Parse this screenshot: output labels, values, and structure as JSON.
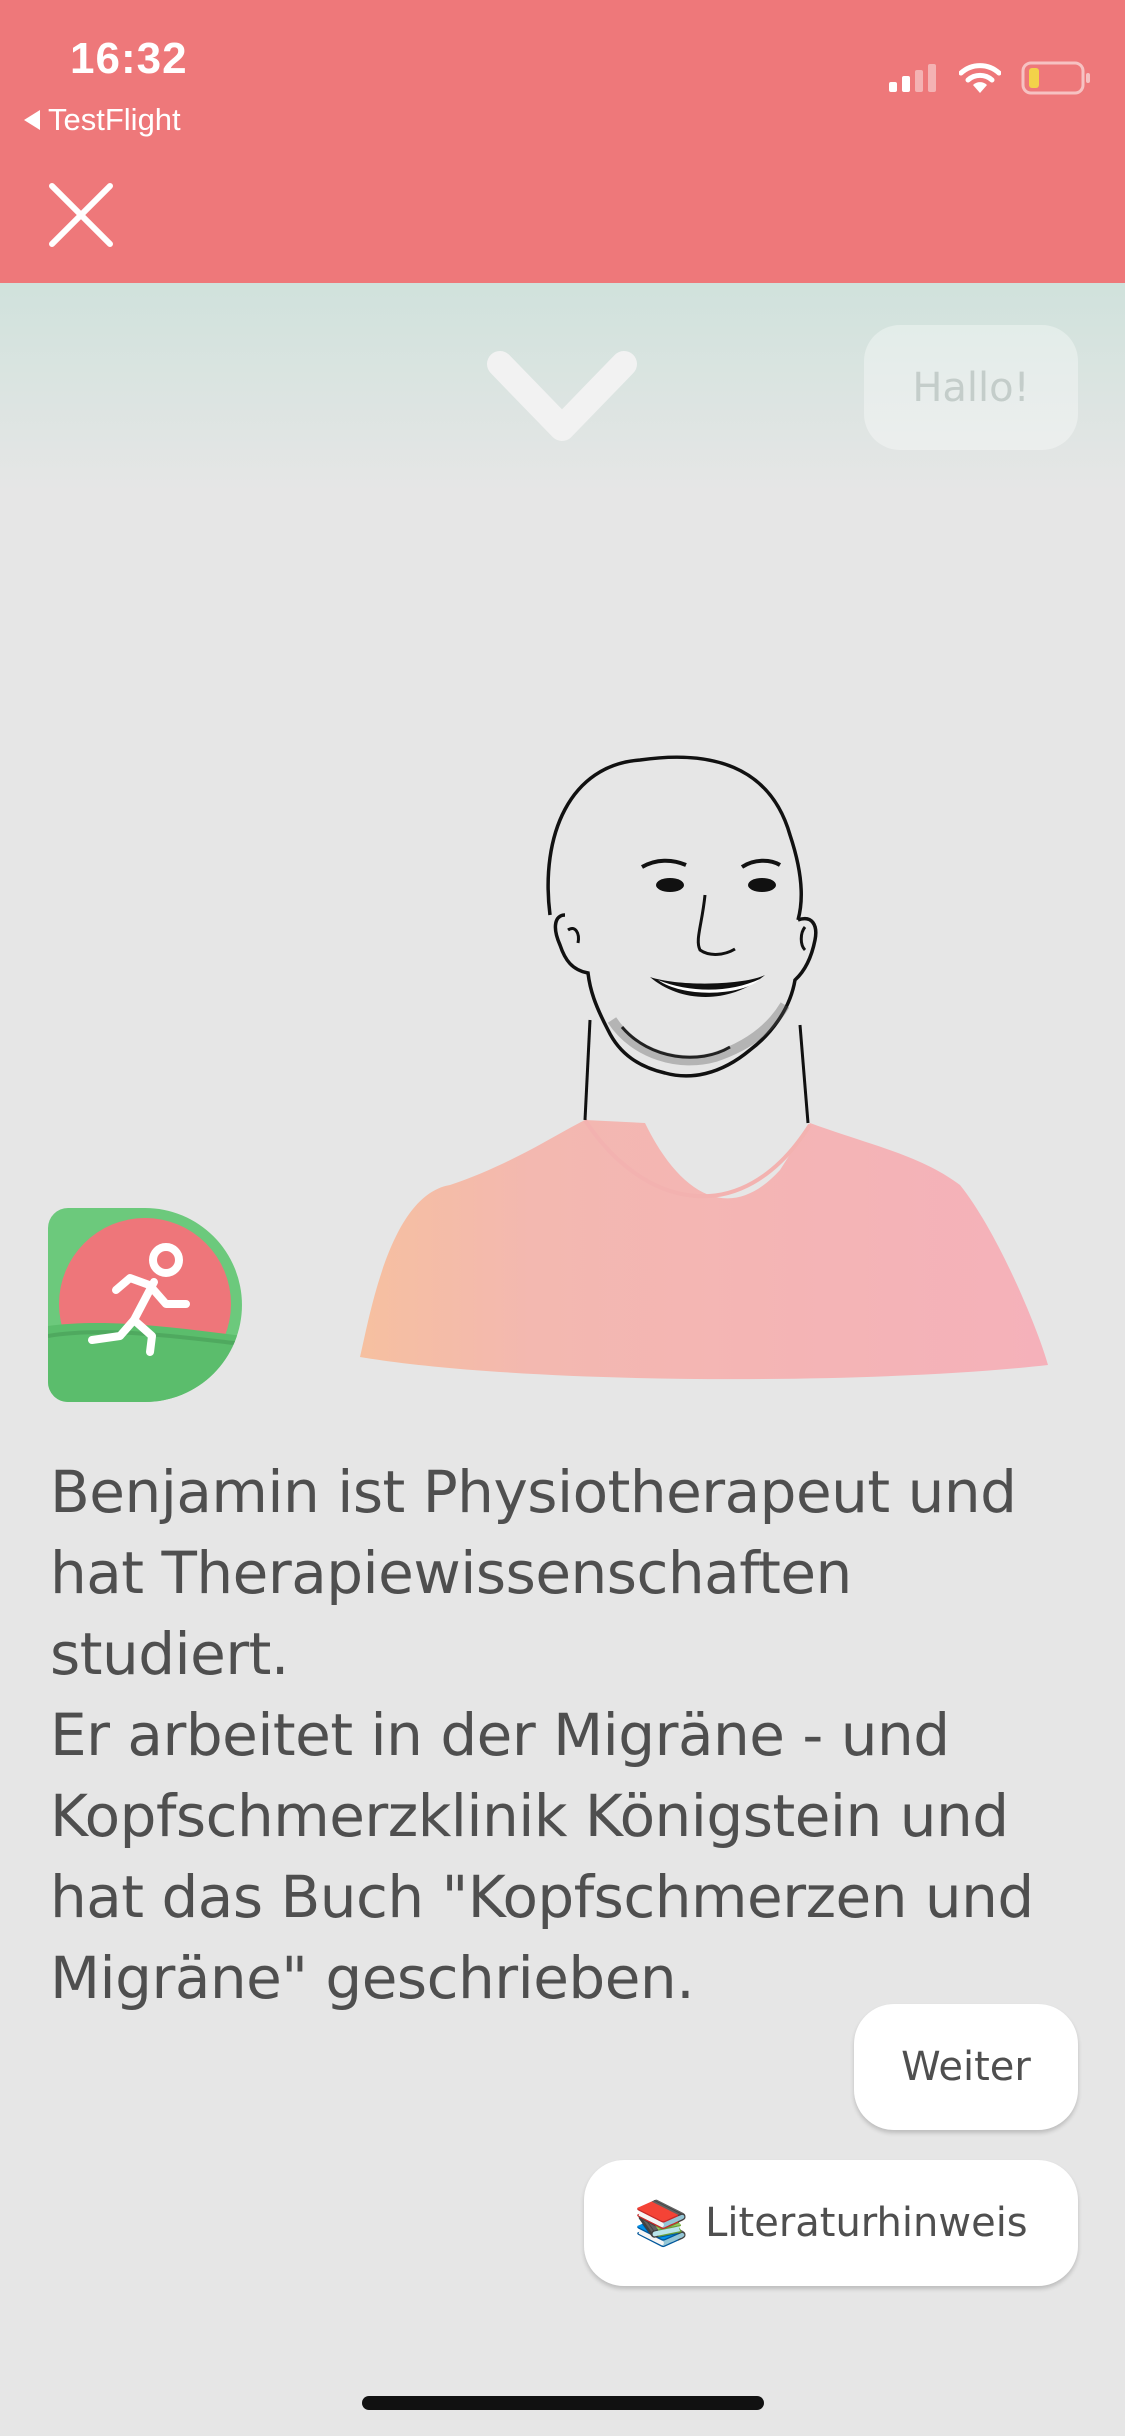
{
  "status_bar": {
    "time": "16:32",
    "back_app": "TestFlight",
    "icons": [
      "cellular-signal-icon",
      "wifi-icon",
      "battery-low-icon"
    ]
  },
  "header": {
    "background_color": "#ee787a",
    "close_icon": "close-icon"
  },
  "chat": {
    "previous_message": "Hallo!",
    "collapse_icon": "chevron-down-icon"
  },
  "speaker": {
    "portrait": "benjamin-portrait",
    "badge_icon": "running-person-icon",
    "bio_lines": [
      "Benjamin ist Physiotherapeut und",
      "hat Therapiewissenschaften studiert.",
      "Er arbeitet in der Migräne - und",
      "Kopfschmerzklinik Königstein und",
      "hat das Buch \"Kopfschmerzen und",
      "Migräne\" geschrieben."
    ]
  },
  "replies": {
    "continue_label": "Weiter",
    "literature_emoji": "📚",
    "literature_label": "Literaturhinweis"
  }
}
